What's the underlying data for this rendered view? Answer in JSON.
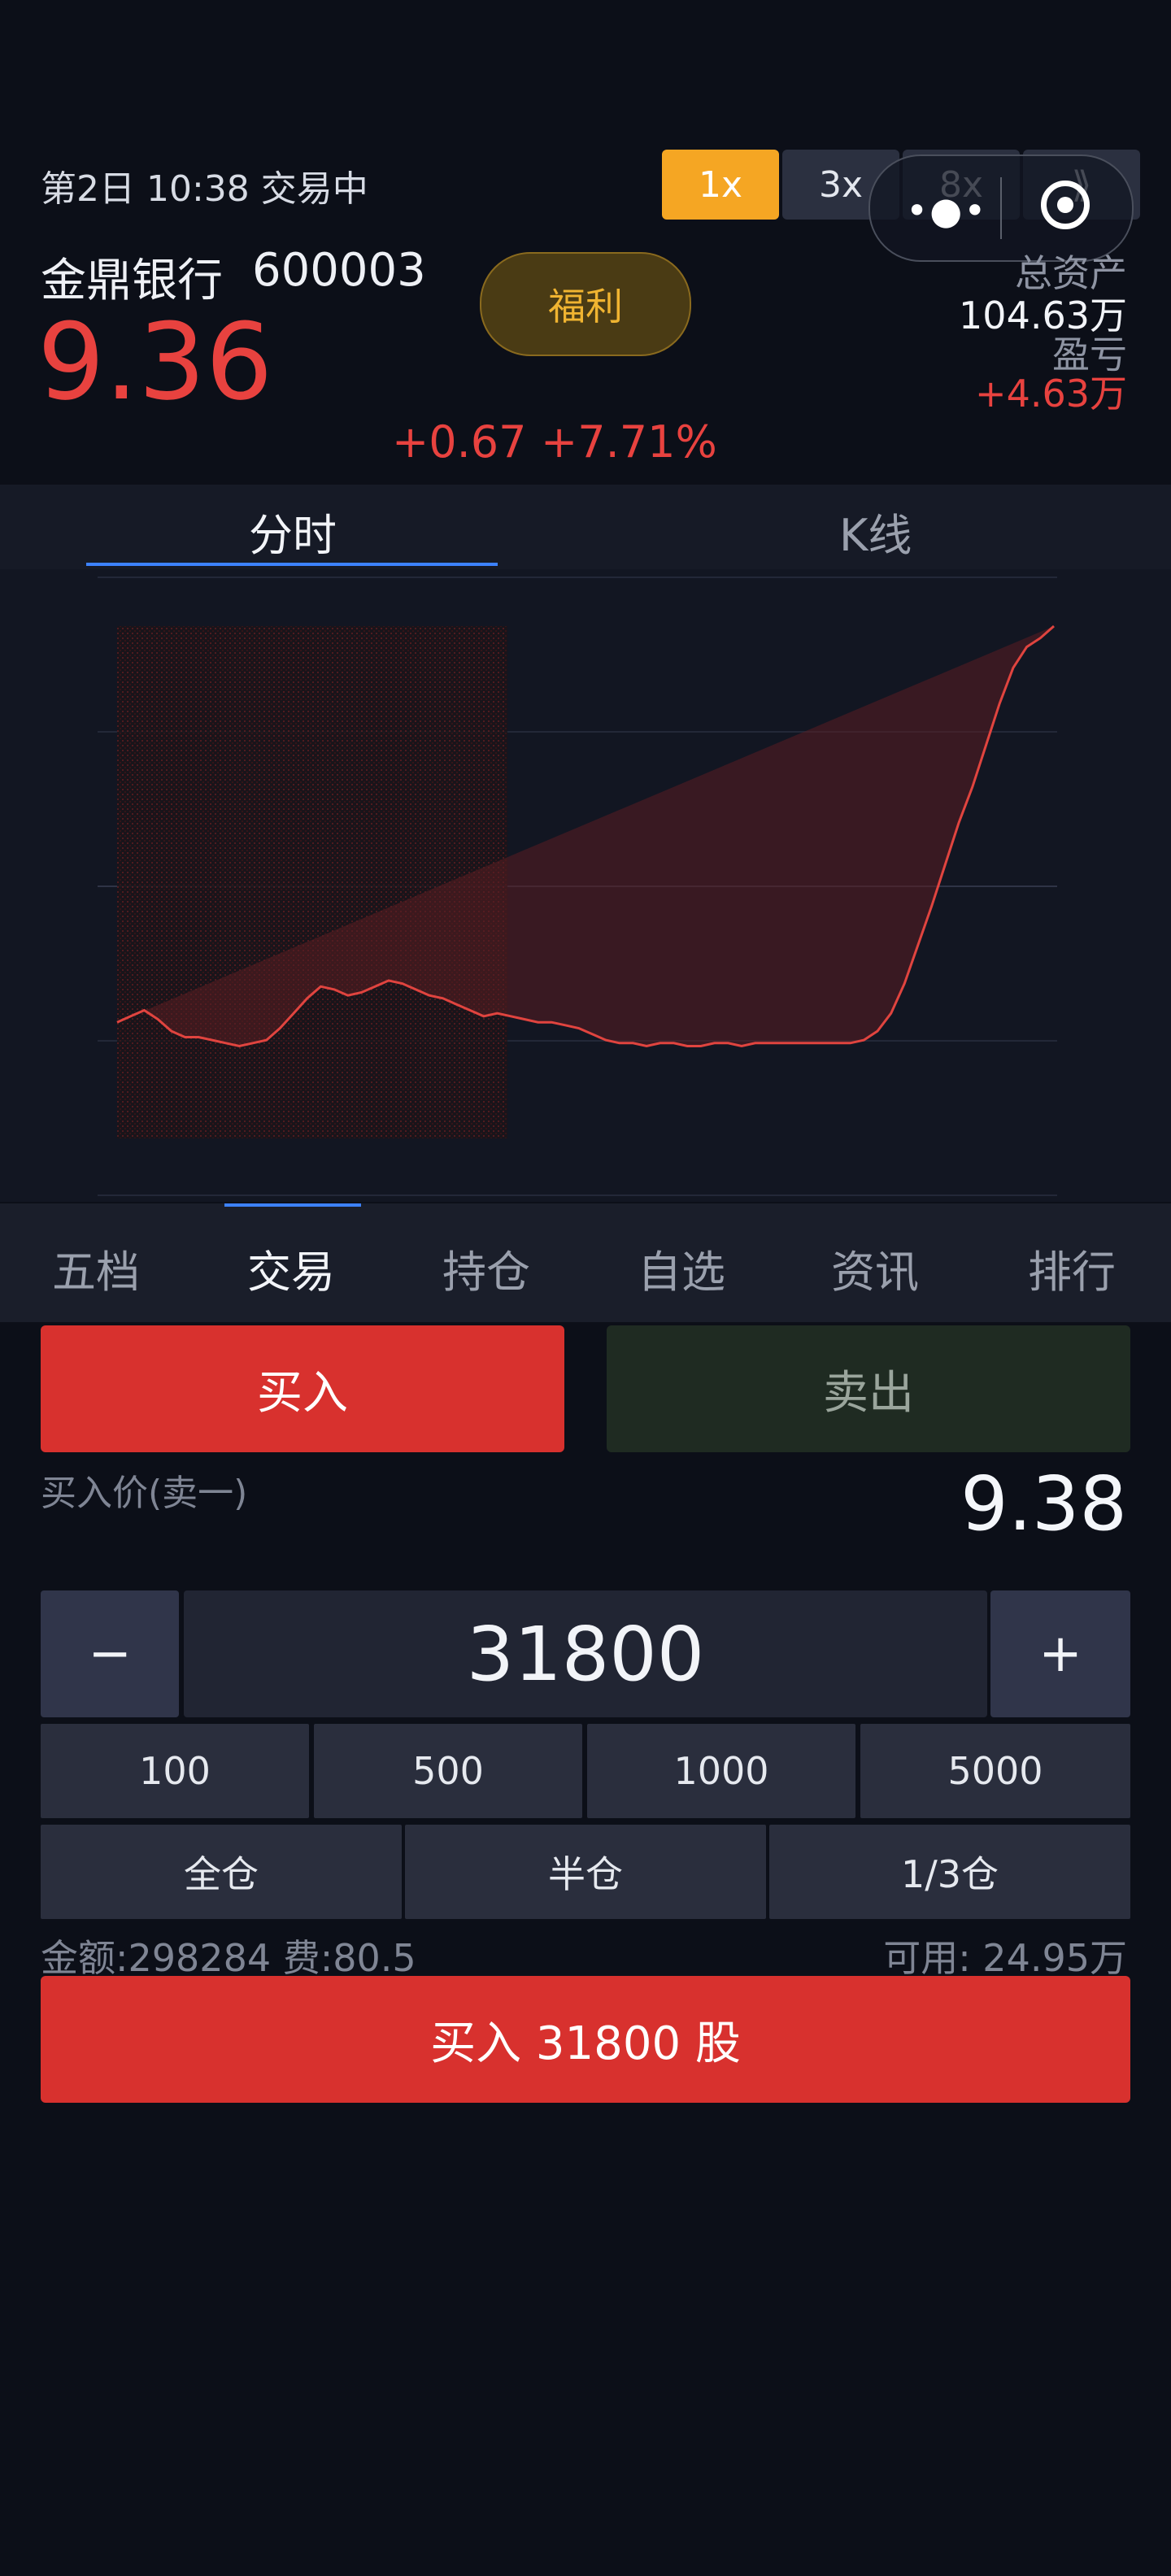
{
  "status": {
    "text": "第2日 10:38 交易中"
  },
  "speed": {
    "options": [
      "1x",
      "3x",
      "8x",
      "⟫"
    ],
    "active": "1x",
    "accent_color": "#f5a623"
  },
  "stock": {
    "name": "金鼎银行",
    "code": "600003",
    "price": "9.36",
    "change_abs": "+0.67",
    "change_pct": "+7.71%",
    "up_color": "#e8423f"
  },
  "welfare": {
    "label": "福利"
  },
  "account": {
    "total_assets_label": "总资产",
    "total_assets_value": "104.63万",
    "pnl_label": "盈亏",
    "pnl_value": "+4.63万"
  },
  "chart_tabs": {
    "fenshi": "分时",
    "kline": "K线",
    "active": "分时"
  },
  "chart_data": {
    "type": "line",
    "ylim": [
      7.64,
      9.36
    ],
    "grid": true,
    "series": [
      {
        "values": [
          8.03,
          8.05,
          8.07,
          8.04,
          8.0,
          7.98,
          7.98,
          7.97,
          7.96,
          7.95,
          7.96,
          7.97,
          8.01,
          8.06,
          8.11,
          8.15,
          8.14,
          8.12,
          8.13,
          8.15,
          8.17,
          8.16,
          8.14,
          8.12,
          8.11,
          8.09,
          8.07,
          8.05,
          8.06,
          8.05,
          8.04,
          8.03,
          8.03,
          8.02,
          8.01,
          7.99,
          7.97,
          7.96,
          7.96,
          7.95,
          7.96,
          7.96,
          7.95,
          7.95,
          7.96,
          7.96,
          7.95,
          7.96,
          7.96,
          7.96,
          7.96,
          7.96,
          7.96,
          7.96,
          7.96,
          7.97,
          8.0,
          8.06,
          8.16,
          8.29,
          8.42,
          8.56,
          8.7,
          8.82,
          8.96,
          9.1,
          9.22,
          9.29,
          9.32,
          9.36
        ]
      }
    ]
  },
  "bottom_tabs": {
    "items": [
      "五档",
      "交易",
      "持仓",
      "自选",
      "资讯",
      "排行"
    ],
    "active": "交易"
  },
  "trade": {
    "buy_label": "买入",
    "sell_label": "卖出",
    "buy_price_label": "买入价(卖一)",
    "buy_price_value": "9.38",
    "minus_label": "−",
    "plus_label": "+",
    "quantity": "31800",
    "qty_presets": [
      "100",
      "500",
      "1000",
      "5000"
    ],
    "position_presets": [
      "全仓",
      "半仓",
      "1/3仓"
    ],
    "amount_text": "金额:298284 费:80.5",
    "available_text": "可用: 24.95万",
    "submit_label": "买入 31800 股",
    "buy_color": "#d8312e",
    "sell_color": "#1f2b22"
  }
}
